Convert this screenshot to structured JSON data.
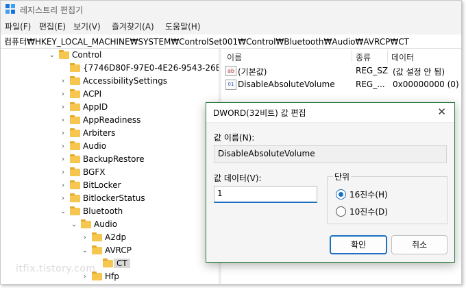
{
  "window": {
    "title": "레지스트리 편집기",
    "accent": "#2a7d3e"
  },
  "menu": {
    "items": [
      "파일(F)",
      "편집(E)",
      "보기(V)",
      "즐겨찾기(A)",
      "도움말(H)"
    ]
  },
  "address": {
    "path": "컴퓨터₩HKEY_LOCAL_MACHINE₩SYSTEM₩ControlSet001₩Control₩Bluetooth₩Audio₩AVRCP₩CT"
  },
  "tree": {
    "items": [
      {
        "label": "Control",
        "chevron": "expanded"
      },
      {
        "label": "{7746D80F-97E0-4E26-9543-26B",
        "chevron": "none"
      },
      {
        "label": "AccessibilitySettings",
        "chevron": "collapsed"
      },
      {
        "label": "ACPI",
        "chevron": "collapsed"
      },
      {
        "label": "AppID",
        "chevron": "collapsed"
      },
      {
        "label": "AppReadiness",
        "chevron": "collapsed"
      },
      {
        "label": "Arbiters",
        "chevron": "collapsed"
      },
      {
        "label": "Audio",
        "chevron": "collapsed"
      },
      {
        "label": "BackupRestore",
        "chevron": "collapsed"
      },
      {
        "label": "BGFX",
        "chevron": "collapsed"
      },
      {
        "label": "BitLocker",
        "chevron": "collapsed"
      },
      {
        "label": "BitlockerStatus",
        "chevron": "collapsed"
      },
      {
        "label": "Bluetooth",
        "chevron": "expanded"
      },
      {
        "label": "Audio",
        "chevron": "expanded"
      },
      {
        "label": "A2dp",
        "chevron": "collapsed"
      },
      {
        "label": "AVRCP",
        "chevron": "expanded"
      },
      {
        "label": "CT",
        "chevron": "none"
      },
      {
        "label": "Hfp",
        "chevron": "collapsed"
      }
    ]
  },
  "list": {
    "headers": [
      "이름",
      "종류",
      "데이터"
    ],
    "rows": [
      {
        "icon": "string-value-icon",
        "icon_text": "ab",
        "name": "(기본값)",
        "type": "REG_SZ",
        "data": "(값 설정 안 됨)"
      },
      {
        "icon": "binary-value-icon",
        "icon_text": "01",
        "name": "DisableAbsoluteVolume",
        "type": "REG_...",
        "data": "0x00000000 (0)"
      }
    ]
  },
  "dialog": {
    "title": "DWORD(32비트) 값 편집",
    "name_label": "값 이름(N):",
    "name_value": "DisableAbsoluteVolume",
    "data_label": "값 데이터(V):",
    "data_value": "1",
    "base_label": "단위",
    "hex_label": "16진수(H)",
    "dec_label": "10진수(D)",
    "hex_checked": true,
    "ok_label": "확인",
    "cancel_label": "취소",
    "close_icon": "close-icon"
  },
  "watermark": "itfix.tistory.com"
}
